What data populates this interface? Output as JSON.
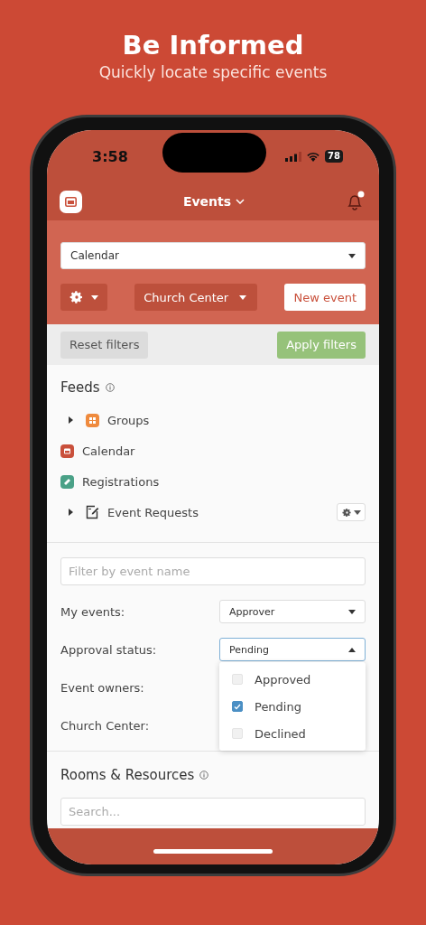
{
  "header": {
    "title": "Be Informed",
    "subtitle": "Quickly locate specific events"
  },
  "status_bar": {
    "time": "3:58",
    "battery": "78"
  },
  "nav": {
    "title": "Events",
    "notification": true
  },
  "calendar_select": {
    "value": "Calendar"
  },
  "toolbar": {
    "filter_button": "Church Center",
    "new_button": "New event"
  },
  "filter_actions": {
    "reset": "Reset filters",
    "apply": "Apply filters"
  },
  "feeds": {
    "title": "Feeds",
    "items": [
      {
        "label": "Groups",
        "kind": "groups",
        "expandable": true,
        "has_settings": false
      },
      {
        "label": "Calendar",
        "kind": "calendar",
        "expandable": false,
        "has_settings": false
      },
      {
        "label": "Registrations",
        "kind": "registrations",
        "expandable": false,
        "has_settings": false
      },
      {
        "label": "Event Requests",
        "kind": "requests",
        "expandable": true,
        "has_settings": true
      }
    ]
  },
  "filters": {
    "name_field": {
      "placeholder": "Filter by event name"
    },
    "rows": [
      {
        "label": "My events:",
        "value": "Approver",
        "open": false
      },
      {
        "label": "Approval status:",
        "value": "Pending",
        "open": true,
        "options": [
          {
            "label": "Approved",
            "checked": false
          },
          {
            "label": "Pending",
            "checked": true
          },
          {
            "label": "Declined",
            "checked": false
          }
        ]
      },
      {
        "label": "Event owners:"
      },
      {
        "label": "Church Center:"
      }
    ]
  },
  "rooms": {
    "title": "Rooms & Resources",
    "search": {
      "placeholder": "Search..."
    }
  }
}
